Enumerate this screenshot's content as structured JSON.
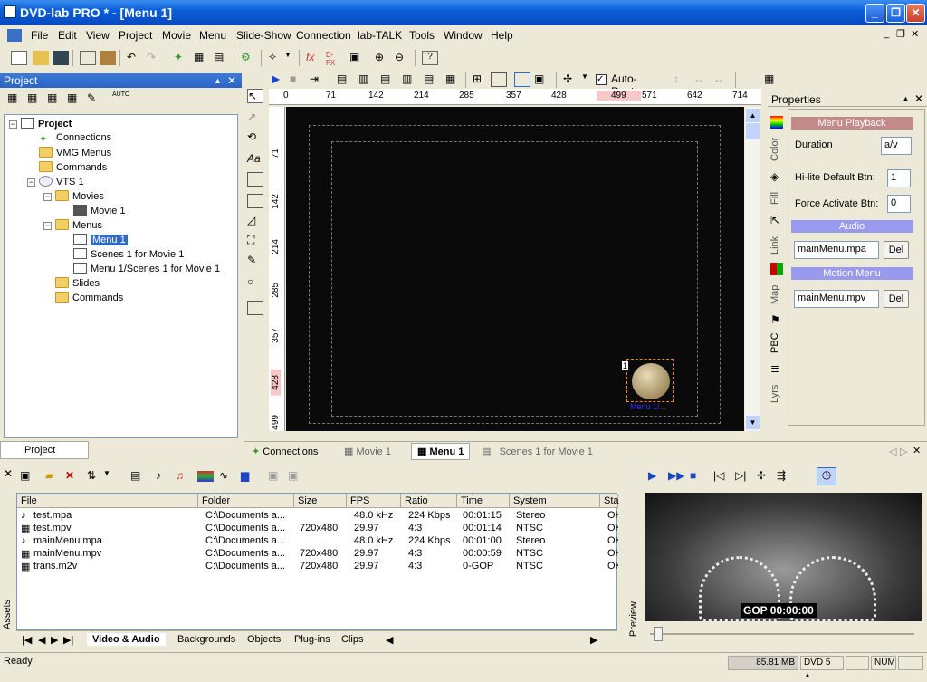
{
  "window": {
    "title": "DVD-lab PRO * - [Menu 1]"
  },
  "menu": [
    "File",
    "Edit",
    "View",
    "Project",
    "Movie",
    "Menu",
    "Slide-Show",
    "Connection",
    "lab-TALK",
    "Tools",
    "Window",
    "Help"
  ],
  "toolbar": {
    "auto_route_label": "Auto-Route"
  },
  "project": {
    "panel_title": "Project",
    "tree": [
      "Project",
      "Connections",
      "VMG Menus",
      "Commands",
      "VTS 1",
      "Movies",
      "Movie 1",
      "Menus",
      "Menu 1",
      "Scenes 1 for Movie 1",
      "Menu 1/Scenes 1 for Movie 1",
      "Slides",
      "Commands"
    ],
    "bottom_tab": "Project"
  },
  "ruler": {
    "h": [
      "0",
      "71",
      "142",
      "214",
      "285",
      "357",
      "428",
      "499",
      "571",
      "642",
      "714"
    ],
    "v": [
      "71",
      "142",
      "214",
      "285",
      "357",
      "428",
      "499"
    ]
  },
  "canvas": {
    "button_number": "1",
    "button_label": "Menu 1/..."
  },
  "properties": {
    "panel_title": "Properties",
    "section_playback": "Menu Playback",
    "duration_label": "Duration",
    "duration_value": "a/v",
    "hilite_label": "Hi-lite Default Btn:",
    "hilite_value": "1",
    "force_label": "Force Activate Btn:",
    "force_value": "0",
    "section_audio": "Audio",
    "audio_file": "mainMenu.mpa",
    "del_label": "Del",
    "section_motion": "Motion Menu",
    "motion_file": "mainMenu.mpv",
    "vtabs": [
      "Color",
      "Fill",
      "Link",
      "Map",
      "PBC",
      "Lyrs"
    ],
    "colors": {
      "section": "#9999ee",
      "playback": "#c48a8a"
    }
  },
  "doc_tabs": [
    "Connections",
    "Movie 1",
    "Menu 1",
    "Scenes 1 for Movie 1"
  ],
  "assets": {
    "side_label": "Assets",
    "columns": [
      "File",
      "Folder",
      "Size",
      "FPS",
      "Ratio",
      "Time",
      "System",
      "Sta"
    ],
    "rows": [
      [
        "test.mpa",
        "C:\\Documents a...",
        "",
        "48.0 kHz",
        "224 Kbps",
        "00:01:15",
        "Stereo",
        "OK"
      ],
      [
        "test.mpv",
        "C:\\Documents a...",
        "720x480",
        "29.97",
        "4:3",
        "00:01:14",
        "NTSC",
        "OK"
      ],
      [
        "mainMenu.mpa",
        "C:\\Documents a...",
        "",
        "48.0 kHz",
        "224 Kbps",
        "00:01:00",
        "Stereo",
        "OK"
      ],
      [
        "mainMenu.mpv",
        "C:\\Documents a...",
        "720x480",
        "29.97",
        "4:3",
        "00:00:59",
        "NTSC",
        "OK"
      ],
      [
        "trans.m2v",
        "C:\\Documents a...",
        "720x480",
        "29.97",
        "4:3",
        "0-GOP",
        "NTSC",
        "OK"
      ]
    ],
    "tabs": [
      "Video & Audio",
      "Backgrounds",
      "Objects",
      "Plug-ins",
      "Clips"
    ]
  },
  "preview": {
    "side_label": "Preview",
    "overlay": "GOP 00:00:00"
  },
  "status": {
    "text": "Ready",
    "memory": "85.81 MB",
    "dvd": "DVD 5",
    "num": "NUM"
  }
}
